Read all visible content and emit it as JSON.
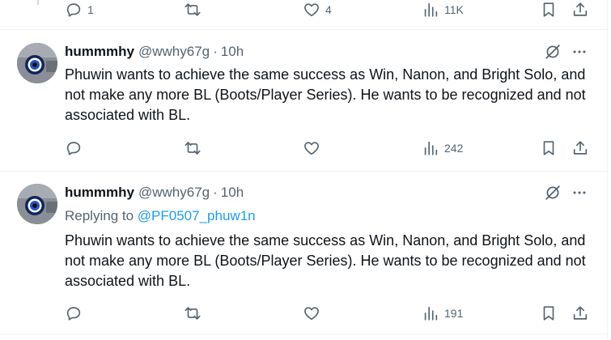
{
  "top_actions": {
    "reply_count": "1",
    "retweet_count": "",
    "like_count": "4",
    "views_count": "11K"
  },
  "tweets": [
    {
      "display_name": "hummmhy",
      "handle": "@wwhy67g",
      "separator": "·",
      "time": "10h",
      "replying_label": "",
      "replying_to": "",
      "text": "Phuwin wants to achieve the same success as Win, Nanon, and Bright Solo, and not make any more BL (Boots/Player Series). He wants to be recognized and not associated with BL.",
      "views_count": "242"
    },
    {
      "display_name": "hummmhy",
      "handle": "@wwhy67g",
      "separator": "·",
      "time": "10h",
      "replying_label": "Replying to",
      "replying_to": "@PF0507_phuw1n",
      "text": "Phuwin wants to achieve the same success as Win, Nanon, and Bright Solo, and not make any more BL (Boots/Player Series). He wants to be recognized and not associated with BL.",
      "views_count": "191"
    }
  ],
  "icons": {
    "reply": "reply-icon",
    "retweet": "retweet-icon",
    "like": "like-icon",
    "views": "views-icon",
    "bookmark": "bookmark-icon",
    "share": "share-icon",
    "grok": "grok-icon",
    "more": "more-icon"
  },
  "colors": {
    "text": "#0f1419",
    "muted": "#536471",
    "link": "#1d9bf0",
    "divider": "#eff3f4"
  }
}
